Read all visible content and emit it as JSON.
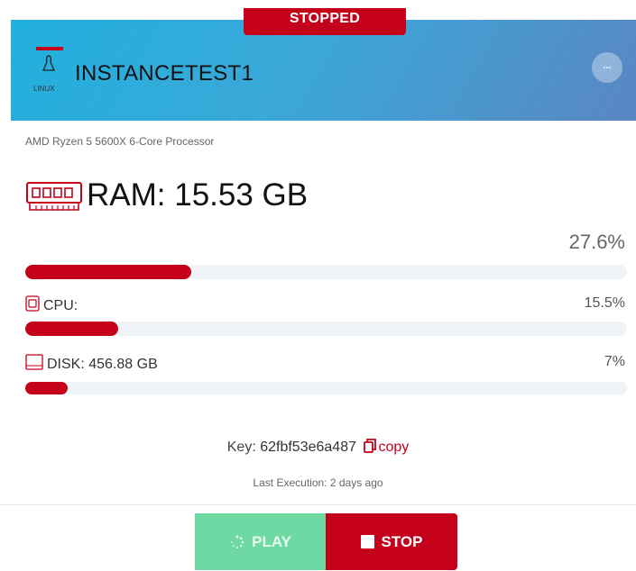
{
  "status": "STOPPED",
  "instance": {
    "name": "INSTANCETEST1",
    "os": "LINUX",
    "processor": "AMD Ryzen 5 5600X 6-Core Processor",
    "menu_label": "..."
  },
  "ram": {
    "label": "RAM: 15.53 GB",
    "percent_text": "27.6%",
    "percent": 27.6,
    "icon": "ram-icon"
  },
  "cpu": {
    "label": "CPU:",
    "percent_text": "15.5%",
    "percent": 15.5,
    "icon": "cpu-icon"
  },
  "disk": {
    "label": "DISK: 456.88 GB",
    "percent_text": "7%",
    "percent": 7,
    "icon": "disk-icon"
  },
  "key": {
    "prefix": "Key:",
    "value": "62fbf53e6a487",
    "copy_label": "copy"
  },
  "last_execution": "Last Execution: 2 days ago",
  "buttons": {
    "play": "PLAY",
    "stop": "STOP"
  },
  "colors": {
    "accent": "#c4001a",
    "play": "#6fd9a3",
    "header_start": "#21b0de",
    "header_end": "#5a86c4",
    "track": "#eef3f8"
  }
}
